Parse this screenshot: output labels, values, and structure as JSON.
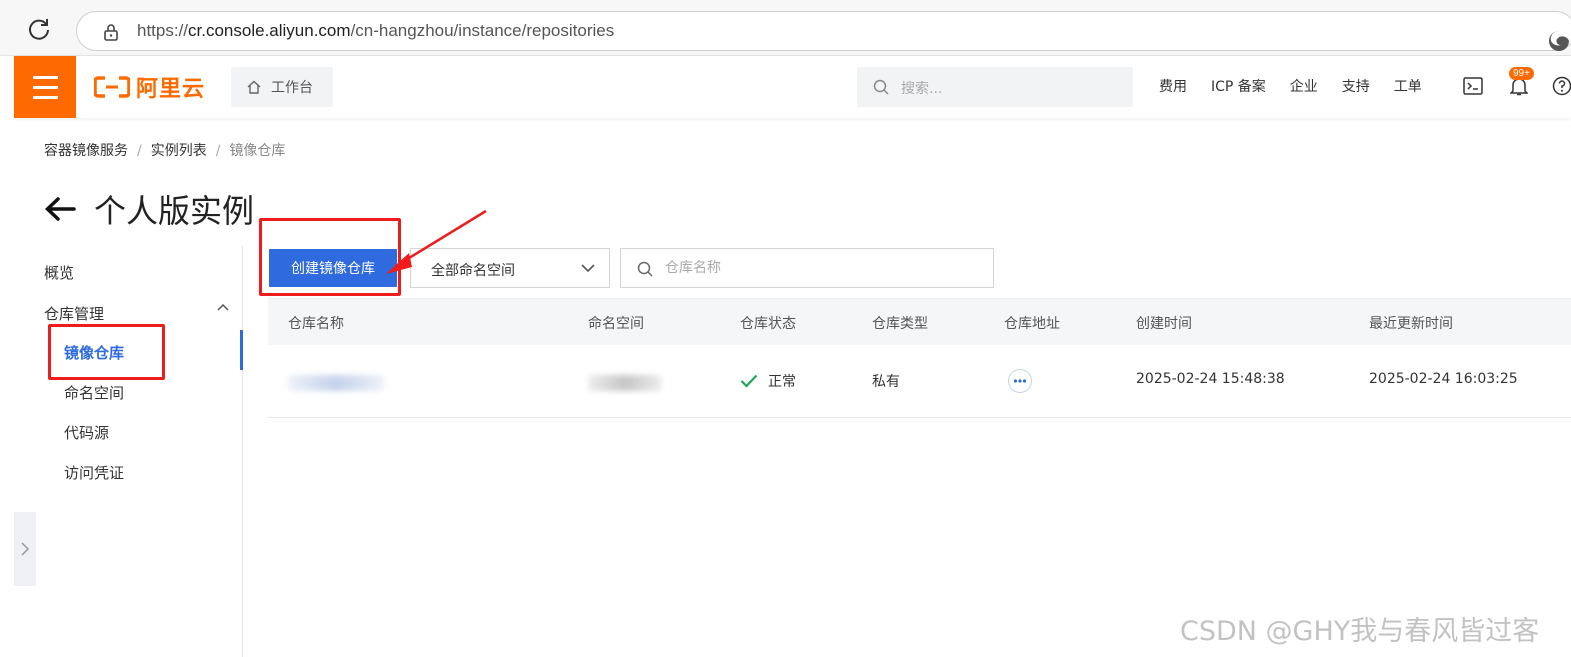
{
  "browser": {
    "url_prefix": "https://",
    "url_host": "cr.console.aliyun.com",
    "url_path": "/cn-hangzhou/instance/repositories"
  },
  "header": {
    "logo_text": "阿里云",
    "workbench_label": "工作台",
    "search_placeholder": "搜索...",
    "nav_links": [
      "费用",
      "ICP 备案",
      "企业",
      "支持",
      "工单"
    ],
    "notification_badge": "99+",
    "brand_color": "#ff6a00"
  },
  "breadcrumb": {
    "items": [
      "容器镜像服务",
      "实例列表",
      "镜像仓库"
    ],
    "separator": "/"
  },
  "page": {
    "title": "个人版实例"
  },
  "sidebar": {
    "overview": "概览",
    "group_label": "仓库管理",
    "items": [
      "镜像仓库",
      "命名空间",
      "代码源",
      "访问凭证"
    ],
    "active_item": "镜像仓库",
    "accent_color": "#2f6bde"
  },
  "toolbar": {
    "create_button": "创建镜像仓库",
    "namespace_select": "全部命名空间",
    "repo_search_placeholder": "仓库名称"
  },
  "table": {
    "columns": [
      "仓库名称",
      "命名空间",
      "仓库状态",
      "仓库类型",
      "仓库地址",
      "创建时间",
      "最近更新时间"
    ],
    "rows": [
      {
        "status": "正常",
        "type": "私有",
        "created": "2025-02-24 15:48:38",
        "updated": "2025-02-24 16:03:25"
      }
    ]
  },
  "watermark": "CSDN @GHY我与春风皆过客"
}
